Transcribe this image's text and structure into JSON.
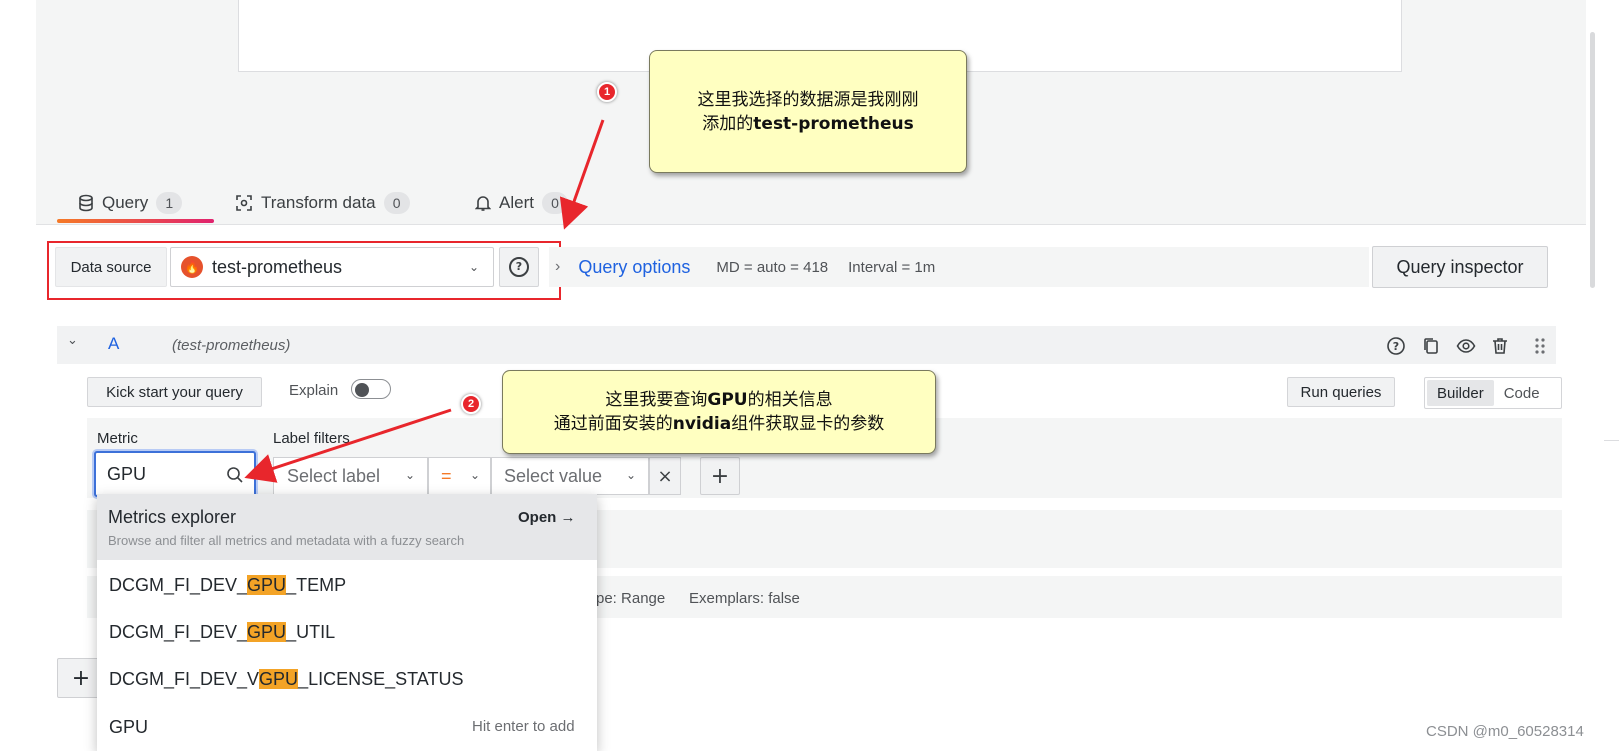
{
  "tabs": [
    {
      "label": "Query",
      "count": "1"
    },
    {
      "label": "Transform data",
      "count": "0"
    },
    {
      "label": "Alert",
      "count": "0"
    }
  ],
  "datasource": {
    "label": "Data source",
    "selected": "test-prometheus"
  },
  "query_options": {
    "title": "Query options",
    "md": "MD = auto = 418",
    "interval": "Interval = 1m",
    "inspector_label": "Query inspector"
  },
  "query_row": {
    "letter": "A",
    "datasource": "(test-prometheus)"
  },
  "toolbar": {
    "kick_start": "Kick start your query",
    "explain": "Explain",
    "run_queries": "Run queries",
    "builder": "Builder",
    "code": "Code"
  },
  "builder": {
    "metric_label": "Metric",
    "metric_value": "GPU",
    "label_filters_label": "Label filters",
    "select_label_placeholder": "Select label",
    "operator": "=",
    "select_value_placeholder": "Select value",
    "close": "×",
    "add": "+"
  },
  "options_row": {
    "type_text": "pe: Range",
    "exemplars_text": "Exemplars: false"
  },
  "dropdown": {
    "title": "Metrics explorer",
    "subtitle": "Browse and filter all metrics and metadata with a fuzzy search",
    "open_label": "Open →",
    "items": [
      {
        "pre": "DCGM_FI_DEV_",
        "match": "GPU",
        "post": "_TEMP"
      },
      {
        "pre": "DCGM_FI_DEV_",
        "match": "GPU",
        "post": "_UTIL"
      },
      {
        "pre": "DCGM_FI_DEV_V",
        "match": "GPU",
        "post": "_LICENSE_STATUS"
      }
    ],
    "custom_value": "GPU",
    "custom_hint": "Hit enter to add"
  },
  "add_query_label": "+",
  "annotations": {
    "callout1_line1": "这里我选择的数据源是我刚刚",
    "callout1_line2_prefix": "添加的",
    "callout1_line2_bold": "test-prometheus",
    "callout2_line1_prefix": "这里我要查询",
    "callout2_line1_bold": "GPU",
    "callout2_line1_suffix": "的相关信息",
    "callout2_line2_prefix": "通过前面安装的",
    "callout2_line2_bold": "nvidia",
    "callout2_line2_suffix": "组件获取显卡的参数",
    "badge1": "1",
    "badge2": "2"
  },
  "watermark": "CSDN @m0_60528314",
  "colors": {
    "accent_blue": "#1f62e0",
    "highlight": "#f3a326",
    "annotation_red": "#e8262c",
    "callout_bg": "#ffffc1"
  }
}
